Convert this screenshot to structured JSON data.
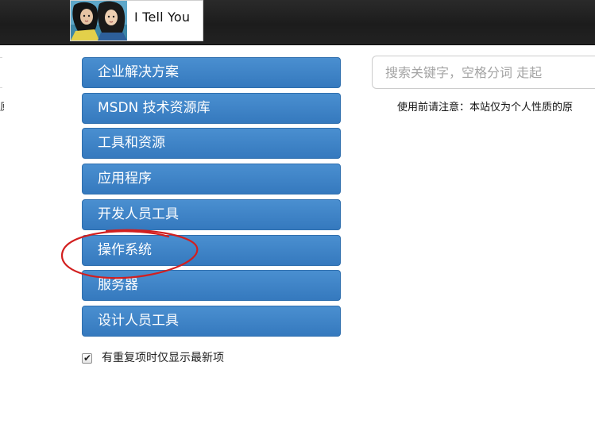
{
  "header": {
    "site_name": "I Tell You"
  },
  "sidebar": {
    "items": [
      {
        "label": "企业解决方案"
      },
      {
        "label": "MSDN 技术资源库"
      },
      {
        "label": "工具和资源"
      },
      {
        "label": "应用程序"
      },
      {
        "label": "开发人员工具"
      },
      {
        "label": "操作系统"
      },
      {
        "label": "服务器"
      },
      {
        "label": "设计人员工具"
      }
    ],
    "checkbox": {
      "label": "有重复项时仅显示最新项",
      "checked": true
    }
  },
  "search": {
    "placeholder": "搜索关键字，空格分词 走起",
    "value": ""
  },
  "notice": {
    "text": "使用前请注意：本站仅为个人性质的原"
  },
  "edge": {
    "fragment": "原"
  },
  "colors": {
    "menu_blue": "#3d82c6",
    "topbar": "#1f1f1f",
    "annotation_red": "#d21f1f"
  }
}
